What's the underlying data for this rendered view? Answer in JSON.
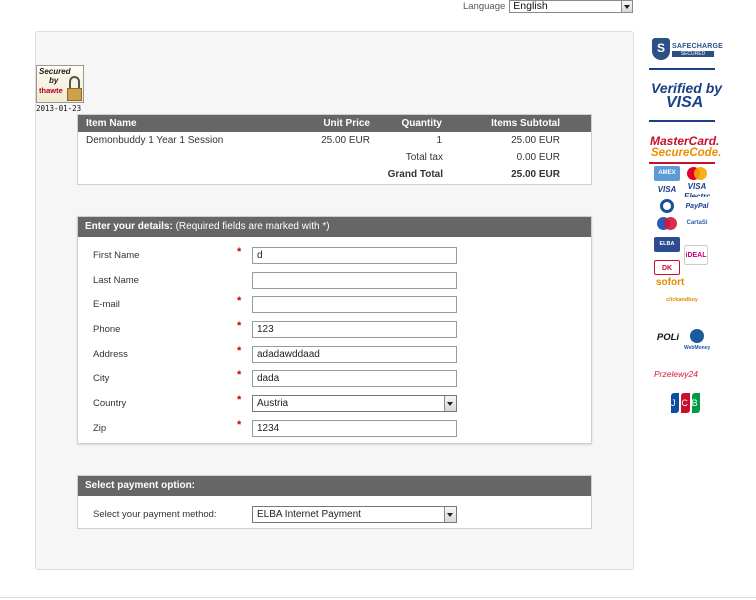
{
  "language": {
    "label": "Language",
    "selected": "English"
  },
  "badge": {
    "line1": "Secured",
    "line2": "by",
    "brand": "thawte",
    "date": "2013-01-23"
  },
  "order": {
    "headers": [
      "Item Name",
      "Unit Price",
      "Quantity",
      "Items Subtotal"
    ],
    "item": {
      "name": "Demonbuddy 1 Year 1 Session",
      "unit_price": "25.00 EUR",
      "quantity": "1",
      "subtotal": "25.00 EUR"
    },
    "tax_label": "Total tax",
    "tax_value": "0.00 EUR",
    "grand_total_label": "Grand Total",
    "grand_total_value": "25.00 EUR"
  },
  "details": {
    "title": "Enter your details:",
    "subtitle": " (Required fields are marked with *)",
    "required_mark": "*",
    "fields": [
      {
        "label": "First Name",
        "value": "d",
        "required": true
      },
      {
        "label": "Last Name",
        "value": "",
        "required": false
      },
      {
        "label": "E-mail",
        "value": "",
        "required": true
      },
      {
        "label": "Phone",
        "value": "123",
        "required": true
      },
      {
        "label": "Address",
        "value": "adadawddaad",
        "required": true
      },
      {
        "label": "City",
        "value": "dada",
        "required": true
      },
      {
        "label": "Country",
        "value": "Austria",
        "required": true
      },
      {
        "label": "Zip",
        "value": "1234",
        "required": true
      }
    ]
  },
  "payment": {
    "title": "Select payment option:",
    "label": "Select your payment method:",
    "selected": "ELBA Internet Payment"
  },
  "logos": {
    "safecharge": "SAFECHARGE",
    "safecharge_sub": "SECURED",
    "vbv_line1": "Verified by",
    "vbv_line2": "VISA",
    "msc_line1": "MasterCard.",
    "msc_line2": "SecureCode.",
    "amex": "AMEX",
    "visa": "VISA",
    "visa_electron": "VISA Electron",
    "paypal": "PayPal",
    "cartasi": "CartaSi",
    "elba": "ELBA VISA",
    "ideal": "iDEAL",
    "dankort": "DK",
    "sofort": "sofort",
    "clickandbuy": "clickandbuy",
    "poli": "POLi",
    "webmoney": "WebMoney",
    "przelewy": "Przelewy24",
    "jcb": [
      "J",
      "C",
      "B"
    ]
  },
  "colors": {
    "header_bg": "#666666",
    "panel_bg": "#f6f6f6",
    "required": "#cc0000"
  }
}
